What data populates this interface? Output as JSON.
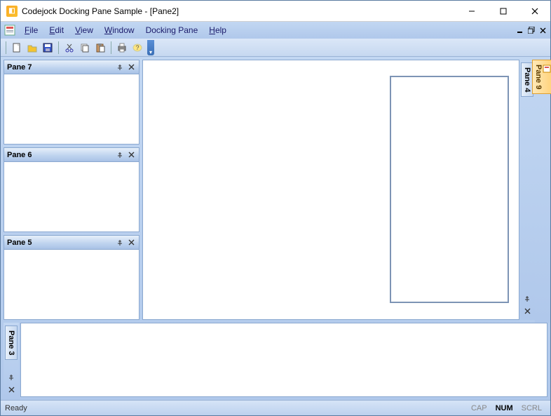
{
  "titlebar": {
    "title": "Codejock Docking Pane Sample - [Pane2]"
  },
  "menu": {
    "items": [
      {
        "label": "File",
        "accel": "F"
      },
      {
        "label": "Edit",
        "accel": "E"
      },
      {
        "label": "View",
        "accel": "V"
      },
      {
        "label": "Window",
        "accel": "W"
      },
      {
        "label": "Docking Pane",
        "accel": ""
      },
      {
        "label": "Help",
        "accel": "H"
      }
    ]
  },
  "toolbar": {
    "buttons": [
      "new",
      "open",
      "save",
      "cut",
      "copy",
      "paste",
      "print",
      "about"
    ]
  },
  "panes": {
    "left": [
      {
        "title": "Pane 7"
      },
      {
        "title": "Pane 6"
      },
      {
        "title": "Pane 5"
      }
    ],
    "right_autohide": {
      "title": "Pane 4"
    },
    "far_right_autohide": {
      "title": "Pane 9"
    },
    "bottom_autohide": {
      "title": "Pane 3"
    }
  },
  "statusbar": {
    "message": "Ready",
    "indicators": {
      "cap": "CAP",
      "num": "NUM",
      "scrl": "SCRL"
    },
    "num_active": true
  }
}
